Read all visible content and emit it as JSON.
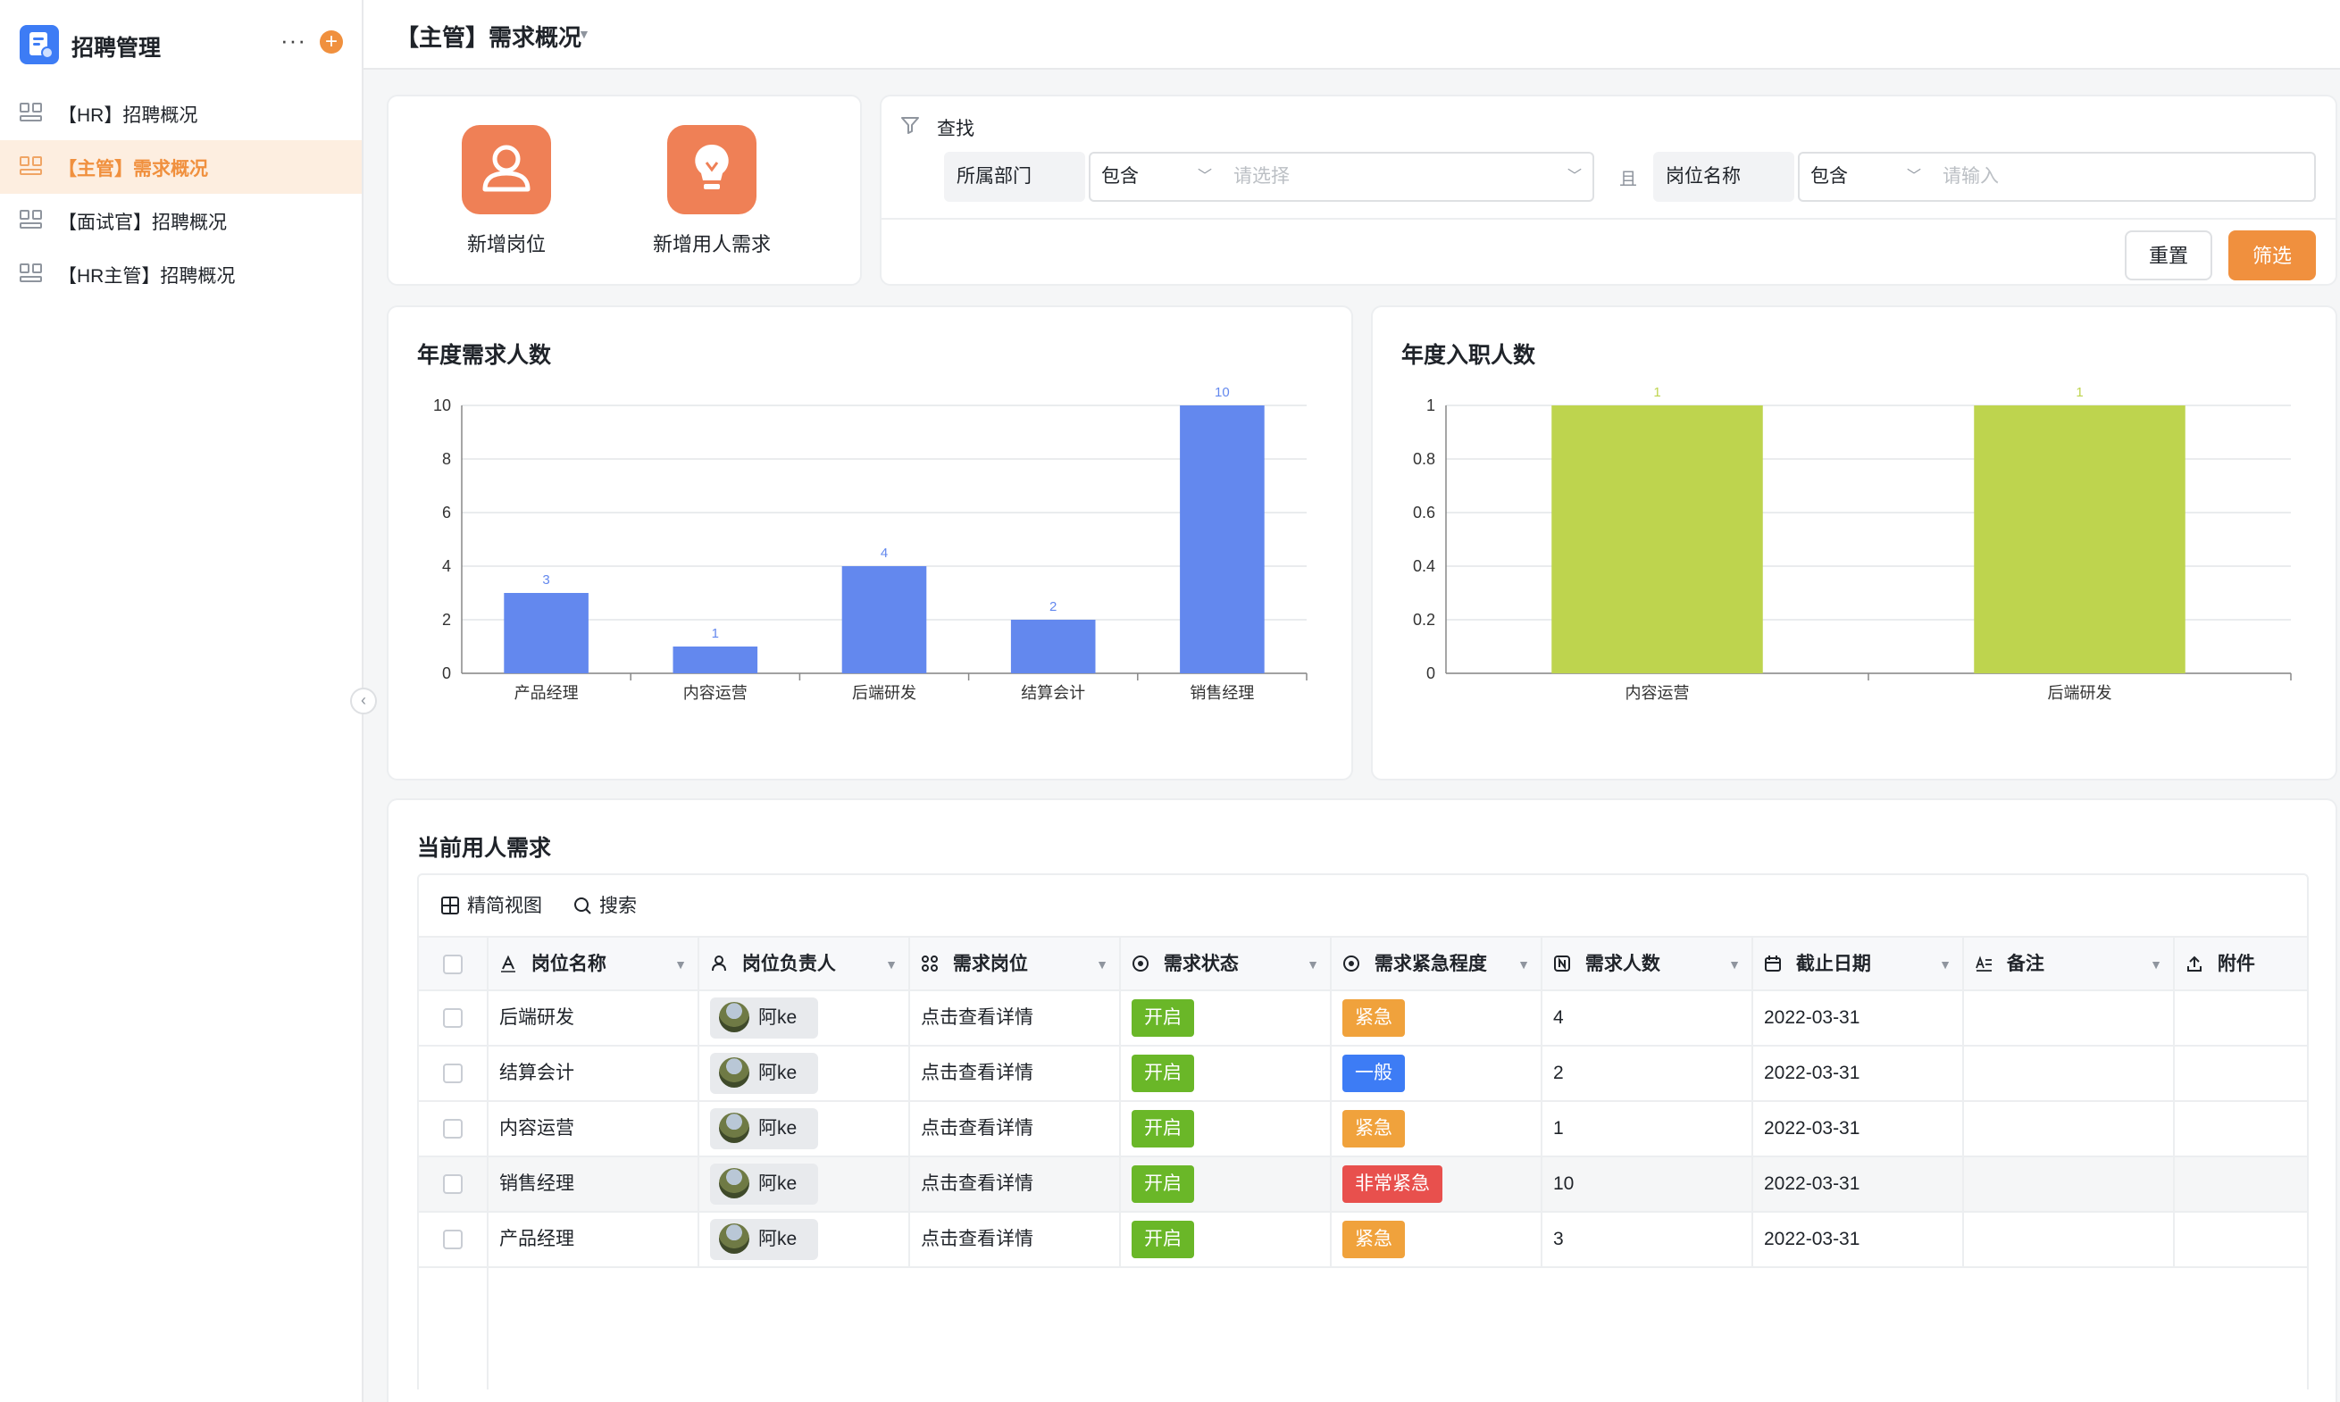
{
  "app": {
    "title": "招聘管理",
    "more": "···",
    "add": "+"
  },
  "sidebar": {
    "items": [
      {
        "label": "【HR】招聘概况"
      },
      {
        "label": "【主管】需求概况"
      },
      {
        "label": "【面试官】招聘概况"
      },
      {
        "label": "【HR主管】招聘概况"
      }
    ],
    "active_index": 1
  },
  "header": {
    "title": "【主管】需求概况"
  },
  "actions": [
    {
      "label": "新增岗位",
      "icon": "people-icon"
    },
    {
      "label": "新增用人需求",
      "icon": "lightbulb-icon"
    }
  ],
  "filter": {
    "title": "查找",
    "conditions": [
      {
        "field": "所属部门",
        "operator": "包含",
        "placeholder": "请选择"
      },
      {
        "field": "岗位名称",
        "operator": "包含",
        "placeholder": "请输入"
      }
    ],
    "joiner": "且",
    "reset_label": "重置",
    "apply_label": "筛选"
  },
  "charts": {
    "demand": {
      "title": "年度需求人数"
    },
    "hired": {
      "title": "年度入职人数"
    }
  },
  "chart_data": [
    {
      "type": "bar",
      "title": "年度需求人数",
      "categories": [
        "产品经理",
        "内容运营",
        "后端研发",
        "结算会计",
        "销售经理"
      ],
      "values": [
        3,
        1,
        4,
        2,
        10
      ],
      "ylim": [
        0,
        10
      ],
      "yticks": [
        0,
        2,
        4,
        6,
        8,
        10
      ],
      "color": "#6388ee",
      "grid": true
    },
    {
      "type": "bar",
      "title": "年度入职人数",
      "categories": [
        "内容运营",
        "后端研发"
      ],
      "values": [
        1,
        1
      ],
      "ylim": [
        0,
        1
      ],
      "yticks": [
        0,
        0.2,
        0.4,
        0.6,
        0.8,
        1
      ],
      "color": "#bed44e",
      "grid": true
    }
  ],
  "table": {
    "title": "当前用人需求",
    "toolbar": {
      "view_label": "精简视图",
      "search_label": "搜索"
    },
    "columns": [
      {
        "label": "岗位名称",
        "icon": "text-icon"
      },
      {
        "label": "岗位负责人",
        "icon": "person-icon"
      },
      {
        "label": "需求岗位",
        "icon": "link-icon"
      },
      {
        "label": "需求状态",
        "icon": "status-icon"
      },
      {
        "label": "需求紧急程度",
        "icon": "status-icon"
      },
      {
        "label": "需求人数",
        "icon": "number-icon"
      },
      {
        "label": "截止日期",
        "icon": "calendar-icon"
      },
      {
        "label": "备注",
        "icon": "note-icon"
      },
      {
        "label": "附件",
        "icon": "upload-icon"
      }
    ],
    "rows": [
      {
        "position": "后端研发",
        "owner": "阿ke",
        "detail": "点击查看详情",
        "status": "开启",
        "urgency": "紧急",
        "count": "4",
        "deadline": "2022-03-31"
      },
      {
        "position": "结算会计",
        "owner": "阿ke",
        "detail": "点击查看详情",
        "status": "开启",
        "urgency": "一般",
        "count": "2",
        "deadline": "2022-03-31"
      },
      {
        "position": "内容运营",
        "owner": "阿ke",
        "detail": "点击查看详情",
        "status": "开启",
        "urgency": "紧急",
        "count": "1",
        "deadline": "2022-03-31"
      },
      {
        "position": "销售经理",
        "owner": "阿ke",
        "detail": "点击查看详情",
        "status": "开启",
        "urgency": "非常紧急",
        "count": "10",
        "deadline": "2022-03-31"
      },
      {
        "position": "产品经理",
        "owner": "阿ke",
        "detail": "点击查看详情",
        "status": "开启",
        "urgency": "紧急",
        "count": "3",
        "deadline": "2022-03-31"
      }
    ]
  },
  "colors": {
    "accent": "#f0903e",
    "status_open": "#6ab728",
    "urgent": "#f0a23c",
    "normal": "#3d7cf5",
    "very_urgent": "#e8504d"
  }
}
